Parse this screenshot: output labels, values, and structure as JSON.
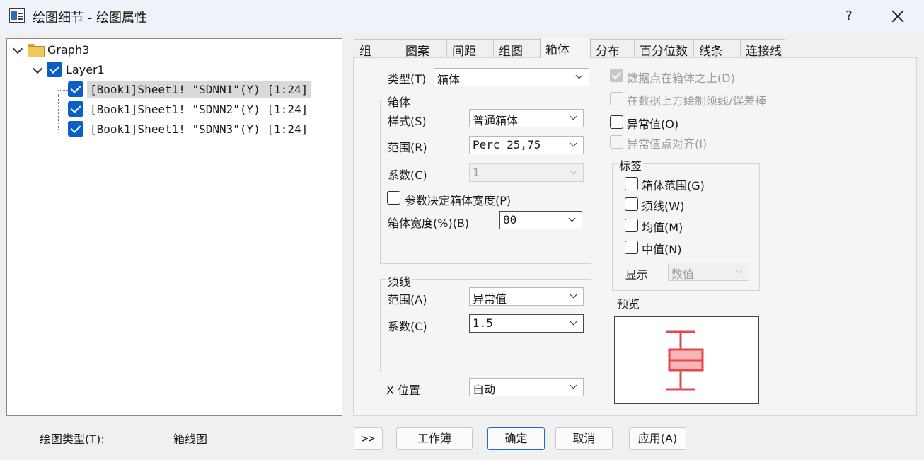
{
  "window": {
    "title": "绘图细节 - 绘图属性",
    "help": "?"
  },
  "tree": {
    "root": "Graph3",
    "layer": "Layer1",
    "plots": [
      "[Book1]Sheet1! \"SDNN1\"(Y) [1:24]",
      "[Book1]Sheet1! \"SDNN2\"(Y) [1:24]",
      "[Book1]Sheet1! \"SDNN3\"(Y) [1:24]"
    ]
  },
  "plot_type": {
    "label": "绘图类型(T):",
    "value": "箱线图"
  },
  "tabs": [
    "组",
    "图案",
    "间距",
    "组图",
    "箱体",
    "分布",
    "百分位数",
    "线条",
    "连接线"
  ],
  "active_tab": "箱体",
  "box": {
    "type_label": "类型(T)",
    "type_value": "箱体",
    "group_title": "箱体",
    "style_label": "样式(S)",
    "style_value": "普通箱体",
    "range_label": "范围(R)",
    "range_value": "Perc 25,75",
    "coef_label": "系数(C)",
    "coef_value": "1",
    "param_width_label": "参数决定箱体宽度(P)",
    "width_label": "箱体宽度(%)(B)",
    "width_value": "80"
  },
  "whisker": {
    "group_title": "须线",
    "range_label": "范围(A)",
    "range_value": "异常值",
    "coef_label": "系数(C)",
    "coef_value": "1.5"
  },
  "xpos": {
    "label": "X 位置",
    "value": "自动"
  },
  "options": {
    "points_above": "数据点在箱体之上(D)",
    "whisker_above": "在数据上方绘制须线/误差棒",
    "outliers": "异常值(O)",
    "outlier_align": "异常值点对齐(I)"
  },
  "labels_group": {
    "title": "标签",
    "box_range": "箱体范围(G)",
    "whisker": "须线(W)",
    "mean": "均值(M)",
    "median": "中值(N)",
    "display_label": "显示",
    "display_value": "数值"
  },
  "preview_label": "预览",
  "buttons": {
    "expand": ">>",
    "workbook": "工作簿",
    "ok": "确定",
    "cancel": "取消",
    "apply": "应用(A)"
  },
  "colors": {
    "checkbox_blue": "#0a5fc6",
    "box_red": "#e0484c",
    "box_fill": "#f7b5b7"
  }
}
